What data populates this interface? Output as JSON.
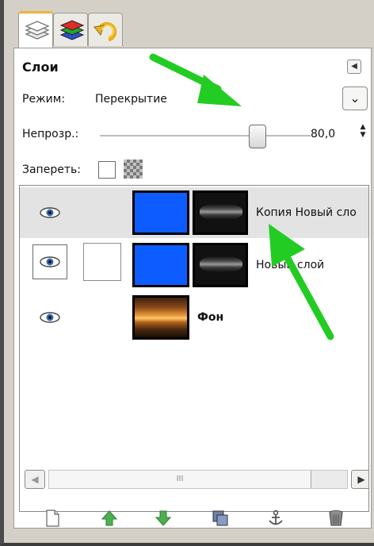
{
  "panel": {
    "title": "Слои",
    "collapse_icon": "triangle-left-icon"
  },
  "mode": {
    "label": "Режим:",
    "value": "Перекрытие"
  },
  "opacity": {
    "label": "Непрозр.:",
    "value": "80,0",
    "level": 80
  },
  "lock": {
    "label": "Запереть:"
  },
  "layers": [
    {
      "name": "Копия Новый сло",
      "selected": true,
      "thumb": "blue",
      "mask": true
    },
    {
      "name": "Новый слой",
      "selected": false,
      "thumb": "blue",
      "mask": true
    },
    {
      "name": "Фон",
      "selected": false,
      "thumb": "photo",
      "mask": false
    }
  ],
  "scrollbar": {
    "thumb_label": "III"
  },
  "toolbar_icons": [
    "new-layer-icon",
    "raise-layer-icon",
    "lower-layer-icon",
    "duplicate-layer-icon",
    "anchor-icon",
    "delete-icon"
  ],
  "colors": {
    "accent_tab": "#f2b33a",
    "blue_layer": "#0d5cff",
    "arrow_green": "#22cc22"
  }
}
